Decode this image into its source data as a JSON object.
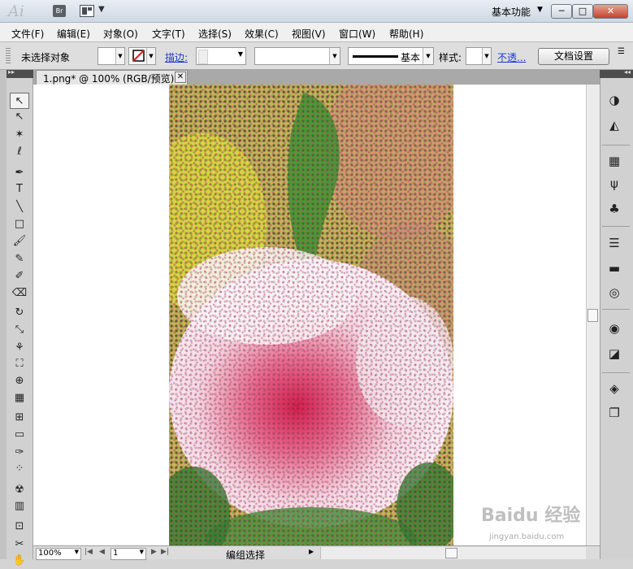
{
  "app": {
    "logo": "Ai",
    "bridge_label": "Br",
    "workspace": "基本功能"
  },
  "window_controls": {
    "minimize": "─",
    "maximize": "□",
    "close": "✕"
  },
  "menu": [
    "文件(F)",
    "编辑(E)",
    "对象(O)",
    "文字(T)",
    "选择(S)",
    "效果(C)",
    "视图(V)",
    "窗口(W)",
    "帮助(H)"
  ],
  "control_bar": {
    "selection_status": "未选择对象",
    "stroke_link": "描边:",
    "brush_label": "基本",
    "style_label": "样式:",
    "opacity_link": "不透...",
    "doc_setup_button": "文档设置"
  },
  "document": {
    "tab_title": "1.png* @ 100% (RGB/预览)"
  },
  "tools": [
    {
      "icon": "selection-tool-icon",
      "glyph": "↖"
    },
    {
      "icon": "direct-selection-tool-icon",
      "glyph": "↖"
    },
    {
      "icon": "magic-wand-tool-icon",
      "glyph": "✶"
    },
    {
      "icon": "lasso-tool-icon",
      "glyph": "ℓ"
    },
    {
      "icon": "pen-tool-icon",
      "glyph": "✒"
    },
    {
      "icon": "type-tool-icon",
      "glyph": "T"
    },
    {
      "icon": "line-tool-icon",
      "glyph": "╲"
    },
    {
      "icon": "rectangle-tool-icon",
      "glyph": "□"
    },
    {
      "icon": "paintbrush-tool-icon",
      "glyph": "🖌"
    },
    {
      "icon": "pencil-tool-icon",
      "glyph": "✎"
    },
    {
      "icon": "blob-brush-tool-icon",
      "glyph": "✐"
    },
    {
      "icon": "eraser-tool-icon",
      "glyph": "⌫"
    },
    {
      "icon": "rotate-tool-icon",
      "glyph": "↻"
    },
    {
      "icon": "scale-tool-icon",
      "glyph": "⤡"
    },
    {
      "icon": "warp-tool-icon",
      "glyph": "⚘"
    },
    {
      "icon": "free-transform-tool-icon",
      "glyph": "⛶"
    },
    {
      "icon": "shape-builder-tool-icon",
      "glyph": "⊕"
    },
    {
      "icon": "perspective-grid-tool-icon",
      "glyph": "▦"
    },
    {
      "icon": "mesh-tool-icon",
      "glyph": "⊞"
    },
    {
      "icon": "gradient-tool-icon",
      "glyph": "▭"
    },
    {
      "icon": "eyedropper-tool-icon",
      "glyph": "✑"
    },
    {
      "icon": "blend-tool-icon",
      "glyph": "⁘"
    },
    {
      "icon": "symbol-sprayer-tool-icon",
      "glyph": "☢"
    },
    {
      "icon": "column-graph-tool-icon",
      "glyph": "▥"
    },
    {
      "icon": "artboard-tool-icon",
      "glyph": "⊡"
    },
    {
      "icon": "slice-tool-icon",
      "glyph": "✂"
    },
    {
      "icon": "hand-tool-icon",
      "glyph": "✋"
    }
  ],
  "panels": [
    {
      "icon": "color-panel-icon",
      "glyph": "◑"
    },
    {
      "icon": "color-guide-panel-icon",
      "glyph": "◭"
    },
    {
      "icon": "swatches-panel-icon",
      "glyph": "▦"
    },
    {
      "icon": "brushes-panel-icon",
      "glyph": "ψ"
    },
    {
      "icon": "symbols-panel-icon",
      "glyph": "♣"
    },
    {
      "icon": "stroke-panel-icon",
      "glyph": "☰"
    },
    {
      "icon": "gradient-panel-icon",
      "glyph": "▬"
    },
    {
      "icon": "transparency-panel-icon",
      "glyph": "◎"
    },
    {
      "icon": "appearance-panel-icon",
      "glyph": "◉"
    },
    {
      "icon": "graphic-styles-panel-icon",
      "glyph": "◪"
    },
    {
      "icon": "layers-panel-icon",
      "glyph": "◈"
    },
    {
      "icon": "artboards-panel-icon",
      "glyph": "❐"
    }
  ],
  "status_bar": {
    "zoom": "100%",
    "page": "1",
    "status_text": "编组选择"
  },
  "watermark": {
    "brand": "Baidu 经验",
    "url": "jingyan.baidu.com"
  }
}
